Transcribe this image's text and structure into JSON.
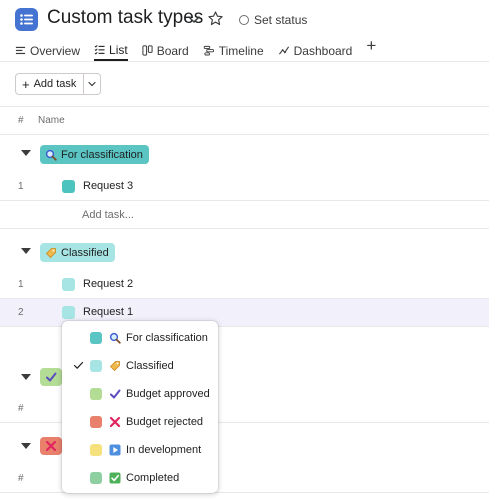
{
  "project": {
    "title": "Custom task types",
    "set_status": "Set status",
    "icon": "list-icon",
    "color": "#4573d2"
  },
  "tabs": [
    {
      "label": "Overview",
      "icon": "overview-icon",
      "active": false
    },
    {
      "label": "List",
      "icon": "list-view-icon",
      "active": true
    },
    {
      "label": "Board",
      "icon": "board-icon",
      "active": false
    },
    {
      "label": "Timeline",
      "icon": "timeline-icon",
      "active": false
    },
    {
      "label": "Dashboard",
      "icon": "dashboard-icon",
      "active": false
    }
  ],
  "toolbar": {
    "add_task_label": "Add task"
  },
  "columns": {
    "number": "#",
    "name": "Name"
  },
  "sections": [
    {
      "label": "For classification",
      "icon": "magnifier-icon",
      "color": "#5ac5c2",
      "tasks": [
        {
          "num": "1",
          "name": "Request 3",
          "color": "#4cc3bf"
        }
      ],
      "add_task": "Add task..."
    },
    {
      "label": "Classified",
      "icon": "tag-icon",
      "color": "#a7e5e4",
      "tasks": [
        {
          "num": "1",
          "name": "Request 2",
          "color": "#a7e5e4"
        },
        {
          "num": "2",
          "name": "Request 1",
          "color": "#a7e5e4"
        }
      ]
    },
    {
      "label": "",
      "icon": "checkmark-icon",
      "color": "#b3dc95",
      "row_num": "#"
    },
    {
      "label": "",
      "icon": "cross-mark-icon",
      "color": "#e8806c",
      "row_num": "#"
    }
  ],
  "dropdown": {
    "selected": "Classified",
    "items": [
      {
        "label": "For classification",
        "icon": "magnifier-icon",
        "color": "#5ac5c2",
        "checked": false
      },
      {
        "label": "Classified",
        "icon": "tag-icon",
        "color": "#a7e5e4",
        "checked": true
      },
      {
        "label": "Budget approved",
        "icon": "checkmark-icon",
        "color": "#b3dc95",
        "checked": false
      },
      {
        "label": "Budget rejected",
        "icon": "cross-mark-icon",
        "color": "#e8806c",
        "checked": false
      },
      {
        "label": "In development",
        "icon": "play-button-icon",
        "color": "#f5e27d",
        "checked": false
      },
      {
        "label": "Completed",
        "icon": "check-box-icon",
        "color": "#8dcfa1",
        "checked": false
      }
    ]
  }
}
